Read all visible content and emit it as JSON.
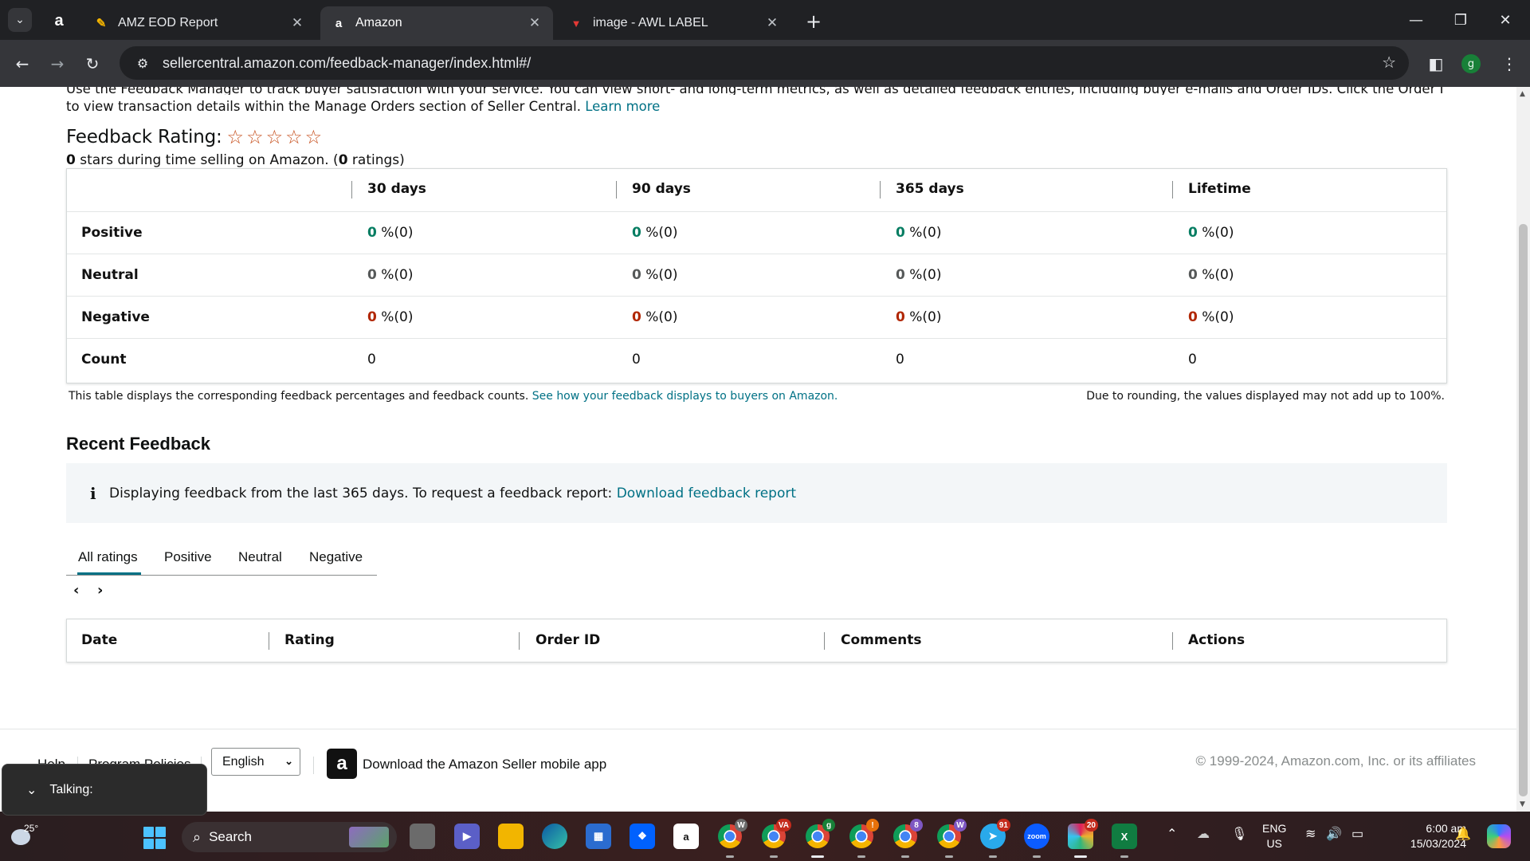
{
  "browser": {
    "tabs": [
      {
        "title": "AMZ EOD Report",
        "favicon": "pencil-icon"
      },
      {
        "title": "Amazon",
        "favicon": "amazon-icon",
        "active": true
      },
      {
        "title": "image - AWL LABEL",
        "favicon": "awl-icon"
      }
    ],
    "url": "sellercentral.amazon.com/feedback-manager/index.html#/",
    "profile_initial": "g"
  },
  "intro": {
    "line1": "Use the Feedback Manager to track buyer satisfaction with your service. You can view short- and long-term metrics, as well as detailed feedback entries, including buyer e-mails and Order IDs. Click the Order ID",
    "line2": "to view transaction details within the Manage Orders section of Seller Central.",
    "learn_more": "Learn more"
  },
  "rating": {
    "heading": "Feedback Rating:",
    "stars_value": "0",
    "stars_text": " stars during time selling on Amazon. (",
    "ratings_count": "0",
    "ratings_suffix": " ratings)"
  },
  "summary_table": {
    "columns": [
      "30 days",
      "90 days",
      "365 days",
      "Lifetime"
    ],
    "rows": [
      {
        "label": "Positive",
        "values": [
          "0",
          "0",
          "0",
          "0"
        ],
        "suffix": "%(0)"
      },
      {
        "label": "Neutral",
        "values": [
          "0",
          "0",
          "0",
          "0"
        ],
        "suffix": "%(0)"
      },
      {
        "label": "Negative",
        "values": [
          "0",
          "0",
          "0",
          "0"
        ],
        "suffix": "%(0)"
      },
      {
        "label": "Count",
        "values": [
          "0",
          "0",
          "0",
          "0"
        ]
      }
    ],
    "note_left": "This table displays the corresponding feedback percentages and feedback counts.",
    "note_link": "See how your feedback displays to buyers on Amazon.",
    "note_right": "Due to rounding, the values displayed may not add up to 100%."
  },
  "recent": {
    "heading": "Recent Feedback",
    "info_text": "Displaying feedback from the last 365 days. To request a feedback report:",
    "info_link": "Download feedback report",
    "tabs": [
      "All ratings",
      "Positive",
      "Neutral",
      "Negative"
    ],
    "active_tab": "All ratings",
    "table_columns": [
      "Date",
      "Rating",
      "Order ID",
      "Comments",
      "Actions"
    ]
  },
  "footer": {
    "help": "Help",
    "program_policies": "Program Policies",
    "language": "English",
    "app_text": "Download the Amazon Seller mobile app",
    "copyright": "© 1999-2024, Amazon.com, Inc. or its affiliates"
  },
  "talking": {
    "label": "Talking:"
  },
  "taskbar": {
    "temperature": "25°",
    "search_label": "Search",
    "lang_line1": "ENG",
    "lang_line2": "US",
    "time": "6:00 am",
    "date": "15/03/2024",
    "badges": {
      "chrome1": "W",
      "chrome2": "VA",
      "chrome3": "g",
      "chrome4": "!",
      "chrome5": "8",
      "chrome6": "W",
      "telegram": "91",
      "slack": "20"
    }
  },
  "colors": {
    "link": "#007185",
    "positive": "#067d62",
    "negative": "#b12704",
    "accent": "#c7511f"
  }
}
